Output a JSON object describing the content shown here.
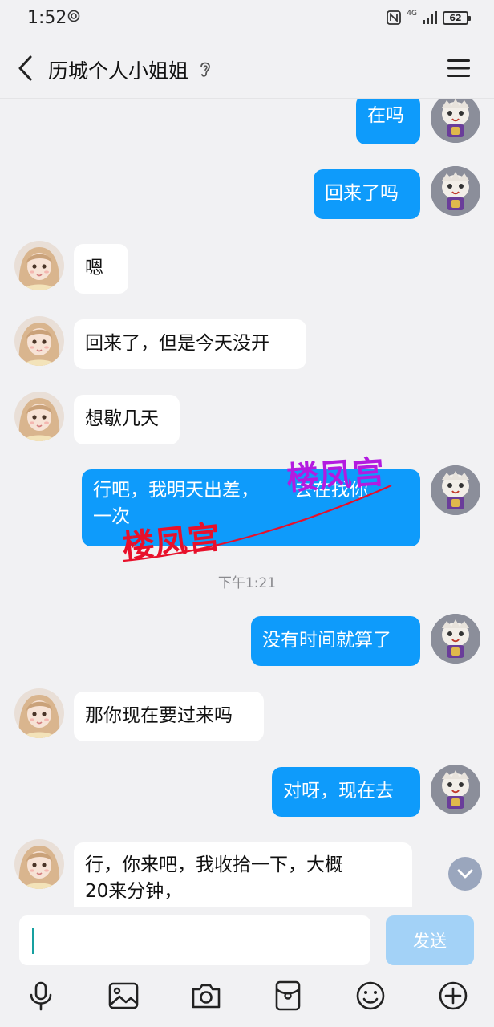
{
  "status_bar": {
    "time": "1:52",
    "network": "4G",
    "battery": "62"
  },
  "header": {
    "title": "历城个人小姐姐"
  },
  "messages": [
    {
      "dir": "out",
      "text": "在吗"
    },
    {
      "dir": "out",
      "text": "回来了吗"
    },
    {
      "dir": "in",
      "text": "嗯"
    },
    {
      "dir": "in",
      "text": "回来了，但是今天没开"
    },
    {
      "dir": "in",
      "text": "想歇几天"
    },
    {
      "dir": "out",
      "text": "行吧，我明天出差，"
    },
    {
      "dir": "out",
      "text": "去在找你"
    },
    {
      "dir": "out",
      "text": "一次"
    },
    {
      "dir": "out",
      "text": "没有时间就算了"
    },
    {
      "dir": "in",
      "text": "那你现在要过来吗"
    },
    {
      "dir": "out",
      "text": "对呀，现在去"
    },
    {
      "dir": "in",
      "text": "行，你来吧，我收拾一下，大概"
    },
    {
      "dir": "in",
      "text": "20来分钟，"
    }
  ],
  "timestamp": "下午1:21",
  "watermark": "楼凤宫",
  "input": {
    "value": "",
    "send_label": "发送"
  },
  "toolbar": [
    "microphone-icon",
    "image-icon",
    "camera-icon",
    "red-packet-icon",
    "emoji-icon",
    "plus-icon"
  ],
  "colors": {
    "outgoing_bubble": "#0e9bfb",
    "incoming_bubble": "#ffffff",
    "background": "#f1f1f3",
    "send_disabled": "#a3d2f7"
  }
}
